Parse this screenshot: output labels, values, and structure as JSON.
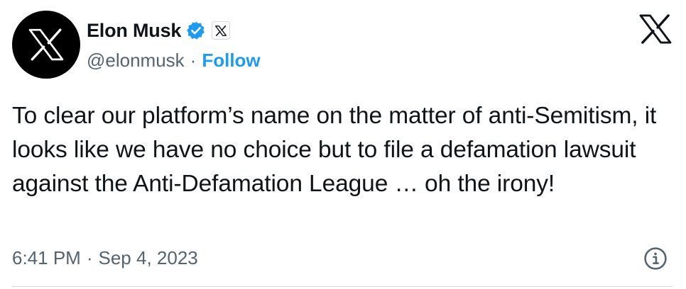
{
  "author": {
    "display_name": "Elon Musk",
    "handle": "@elonmusk",
    "separator": "·",
    "follow_label": "Follow",
    "avatar_icon": "x-logo-icon",
    "verified_icon": "verified-badge-icon",
    "verified_color": "#1d9bf0",
    "affiliate_icon": "x-affiliate-badge-icon"
  },
  "tweet": {
    "text": "To clear our platform’s name on the matter of anti-Semitism, it looks like we have no choice but to file a defamation lawsuit against the Anti-Defamation League … oh the irony!",
    "time": "6:41 PM",
    "time_separator": "·",
    "date": "Sep 4, 2023"
  },
  "icons": {
    "brand": "x-logo-icon",
    "info": "info-icon"
  },
  "colors": {
    "text": "#0f1419",
    "secondary": "#536471",
    "accent": "#1d9bf0",
    "divider": "#cfd9de"
  }
}
